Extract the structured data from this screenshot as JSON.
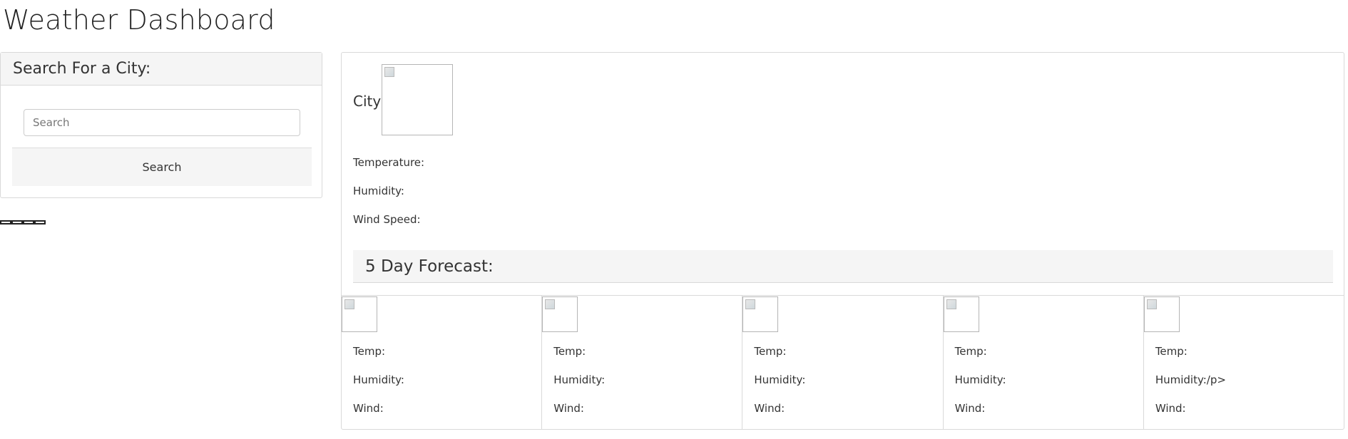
{
  "page": {
    "title": "Weather Dashboard"
  },
  "search": {
    "header": "Search For a City:",
    "placeholder": "Search",
    "value": "",
    "button_label": "Search",
    "history_items": [
      "",
      "",
      "",
      ""
    ]
  },
  "current": {
    "city": "City",
    "icon": "weather-icon",
    "temperature_label": "Temperature:",
    "humidity_label": "Humidity:",
    "wind_label": "Wind Speed:"
  },
  "forecast": {
    "header": "5 Day Forecast:",
    "days": [
      {
        "icon": "weather-icon",
        "temp": "Temp:",
        "humidity": "Humidity:",
        "wind": "Wind:"
      },
      {
        "icon": "weather-icon",
        "temp": "Temp:",
        "humidity": "Humidity:",
        "wind": "Wind:"
      },
      {
        "icon": "weather-icon",
        "temp": "Temp:",
        "humidity": "Humidity:",
        "wind": "Wind:"
      },
      {
        "icon": "weather-icon",
        "temp": "Temp:",
        "humidity": "Humidity:",
        "wind": "Wind:"
      },
      {
        "icon": "weather-icon",
        "temp": "Temp:",
        "humidity": "Humidity:/p>",
        "wind": "Wind:"
      }
    ]
  },
  "colors": {
    "card_border": "#d9d9d9",
    "card_header_bg": "#f5f5f5",
    "text": "#333333"
  }
}
